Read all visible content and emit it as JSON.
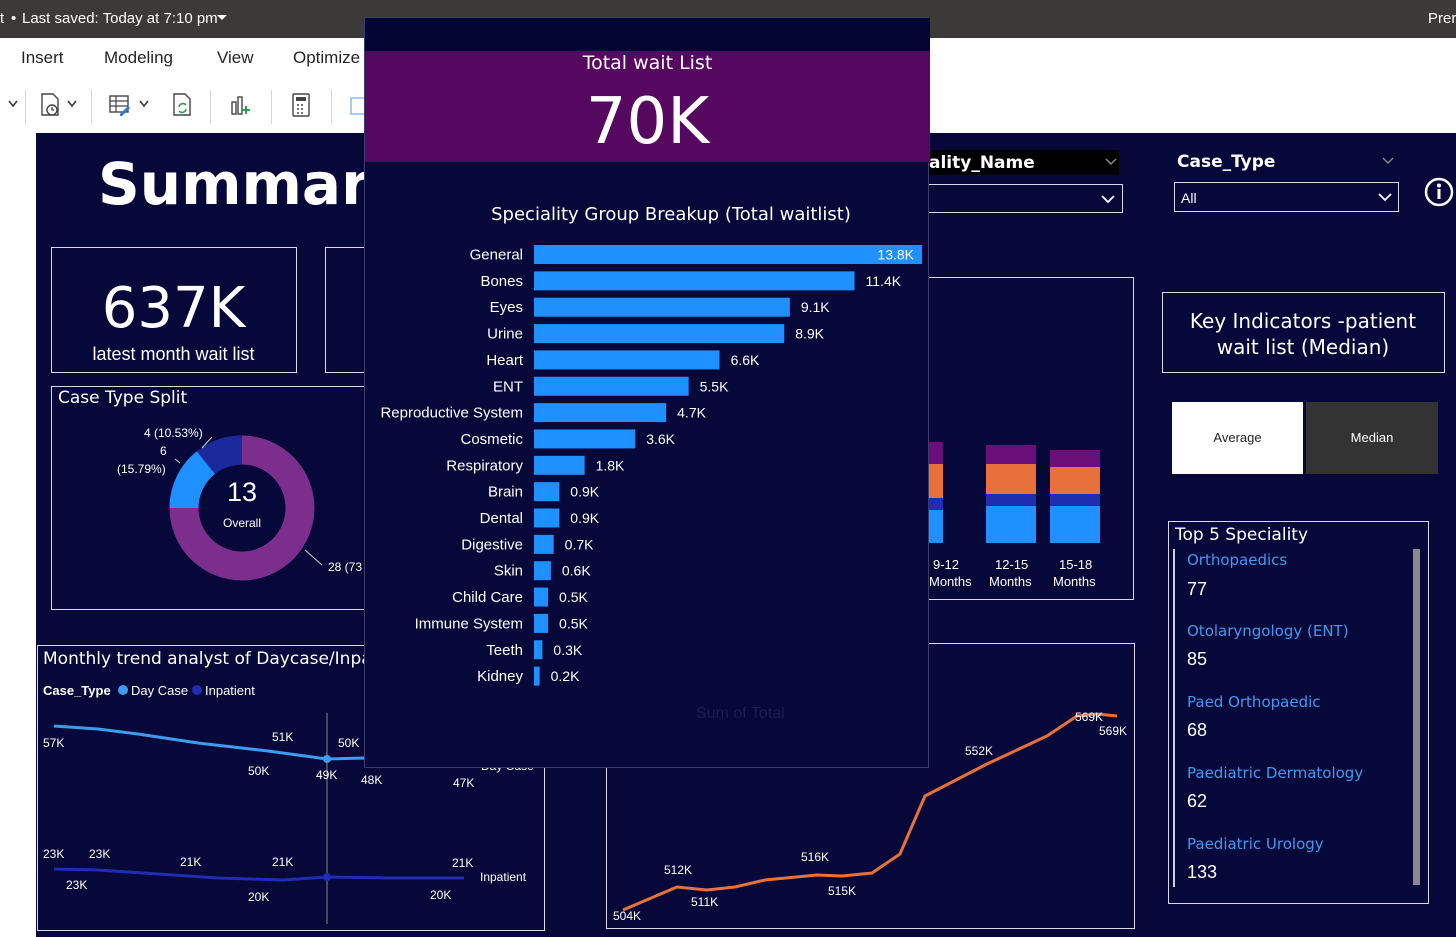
{
  "titlebar": {
    "left_text": "t",
    "saved_text": "Last saved: Today at 7:10 pm",
    "right_text": "Prer"
  },
  "ribbon": {
    "tabs": [
      "Insert",
      "Modeling",
      "View",
      "Optimize"
    ]
  },
  "summary_title": "Summary",
  "kpi_card": {
    "value": "637K",
    "label": "latest month wait list"
  },
  "case_type_split": {
    "title": "Case Type Split",
    "center_value": "13",
    "center_label": "Overall",
    "labels": [
      "4 (10.53%)",
      "6",
      "(15.79%)",
      "28 (73"
    ],
    "colors": {
      "inpatient": "#7b2e8c",
      "daycase": "#1e90ff",
      "other": "#1a2a9c"
    }
  },
  "monthly_trend": {
    "title": "Monthly trend analyst of Daycase/Inpa",
    "legend_label": "Case_Type",
    "legend_items": [
      {
        "name": "Day Case",
        "color": "#3d9bf0"
      },
      {
        "name": "Inpatient",
        "color": "#1f2db0"
      }
    ],
    "daycase_labels": [
      "57K",
      "51K",
      "50K",
      "49K",
      "50K",
      "48K",
      "47K",
      "Day Case"
    ],
    "inpatient_labels": [
      "23K",
      "23K",
      "23K",
      "21K",
      "20K",
      "21K",
      "20K",
      "21K",
      "Inpatient"
    ]
  },
  "filters": {
    "speciality_label": "ality_Name",
    "case_type_label": "Case_Type",
    "case_type_value": "All",
    "info_icon": "info-icon"
  },
  "stacked_chart": {
    "categories": [
      "9-12\nMonths",
      "12-15\nMonths",
      "15-18\nMonths"
    ],
    "cat_lines": [
      [
        "9-12",
        "Months"
      ],
      [
        "12-15",
        "Months"
      ],
      [
        "15-18",
        "Months"
      ]
    ],
    "colors": [
      "#1e90ff",
      "#1f2db0",
      "#e8703a",
      "#6a0f7a"
    ]
  },
  "total_trend": {
    "labels": [
      "504K",
      "512K",
      "511K",
      "516K",
      "515K",
      "552K",
      "569K",
      "569K"
    ],
    "color": "#e8703a"
  },
  "key_indicators": {
    "title_line1": "Key Indicators -patient",
    "title_line2": "wait list (Median)",
    "buttons": [
      "Average",
      "Median"
    ]
  },
  "top5": {
    "title": "Top 5 Speciality",
    "items": [
      {
        "name": "Orthopaedics",
        "value": "77"
      },
      {
        "name": "Otolaryngology (ENT)",
        "value": "85"
      },
      {
        "name": "Paed Orthopaedic",
        "value": "68"
      },
      {
        "name": "Paediatric Dermatology",
        "value": "62"
      },
      {
        "name": "Paediatric Urology",
        "value": "133"
      }
    ]
  },
  "popup": {
    "kpi_title": "Total wait List",
    "kpi_value": "70K",
    "chart_title": "Speciality Group Breakup (Total waitlist)",
    "axis_label": "Sum of Total"
  },
  "chart_data": {
    "type": "bar",
    "title": "Speciality Group Breakup (Total waitlist)",
    "xlabel": "Sum of Total",
    "ylabel": "",
    "bar_color": "#1e90ff",
    "categories": [
      "General",
      "Bones",
      "Eyes",
      "Urine",
      "Heart",
      "ENT",
      "Reproductive System",
      "Cosmetic",
      "Respiratory",
      "Brain",
      "Dental",
      "Digestive",
      "Skin",
      "Child Care",
      "Immune System",
      "Teeth",
      "Kidney"
    ],
    "values": [
      13.8,
      11.4,
      9.1,
      8.9,
      6.6,
      5.5,
      4.7,
      3.6,
      1.8,
      0.9,
      0.9,
      0.7,
      0.6,
      0.5,
      0.5,
      0.3,
      0.2
    ],
    "value_labels": [
      "13.8K",
      "11.4K",
      "9.1K",
      "8.9K",
      "6.6K",
      "5.5K",
      "4.7K",
      "3.6K",
      "1.8K",
      "0.9K",
      "0.9K",
      "0.7K",
      "0.6K",
      "0.5K",
      "0.5K",
      "0.3K",
      "0.2K"
    ],
    "unit": "K"
  }
}
